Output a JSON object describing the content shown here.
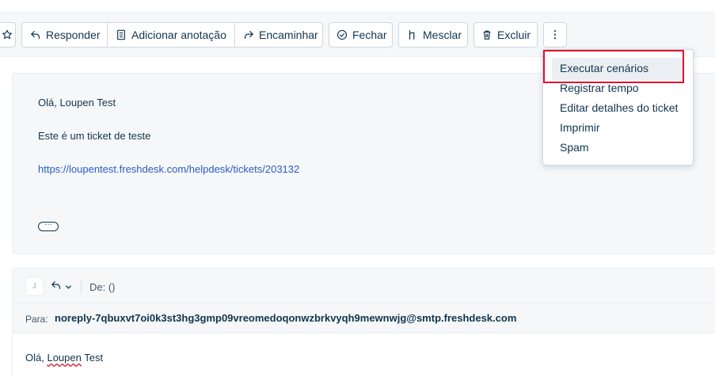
{
  "toolbar": {
    "star_icon": "star-icon",
    "reply": "Responder",
    "add_note": "Adicionar anotação",
    "forward": "Encaminhar",
    "close": "Fechar",
    "merge": "Mesclar",
    "delete": "Excluir",
    "more": "⋮"
  },
  "message": {
    "greeting": "Olá, Loupen Test",
    "body": "Este é um ticket de teste",
    "link": "https://loupentest.freshdesk.com/helpdesk/tickets/203132",
    "expand": "···"
  },
  "reply": {
    "avatar": "J",
    "from": "De: ()",
    "to_label": "Para:",
    "to_value": "noreply-7qbuxvt7oi0k3st3hg3gmp09vreomedoqonwzbrkvyqh9mewnwjg@smtp.freshdesk.com",
    "greeting_prefix": "Olá, ",
    "greeting_name": "Loupen",
    "greeting_suffix": " Test"
  },
  "menu": {
    "items": [
      "Executar cenários",
      "Registrar tempo",
      "Editar detalhes do ticket",
      "Imprimir",
      "Spam"
    ],
    "highlighted_index": 0
  },
  "colors": {
    "highlight_box": "#e0102d",
    "link": "#2c5cc5",
    "text": "#12344d"
  }
}
